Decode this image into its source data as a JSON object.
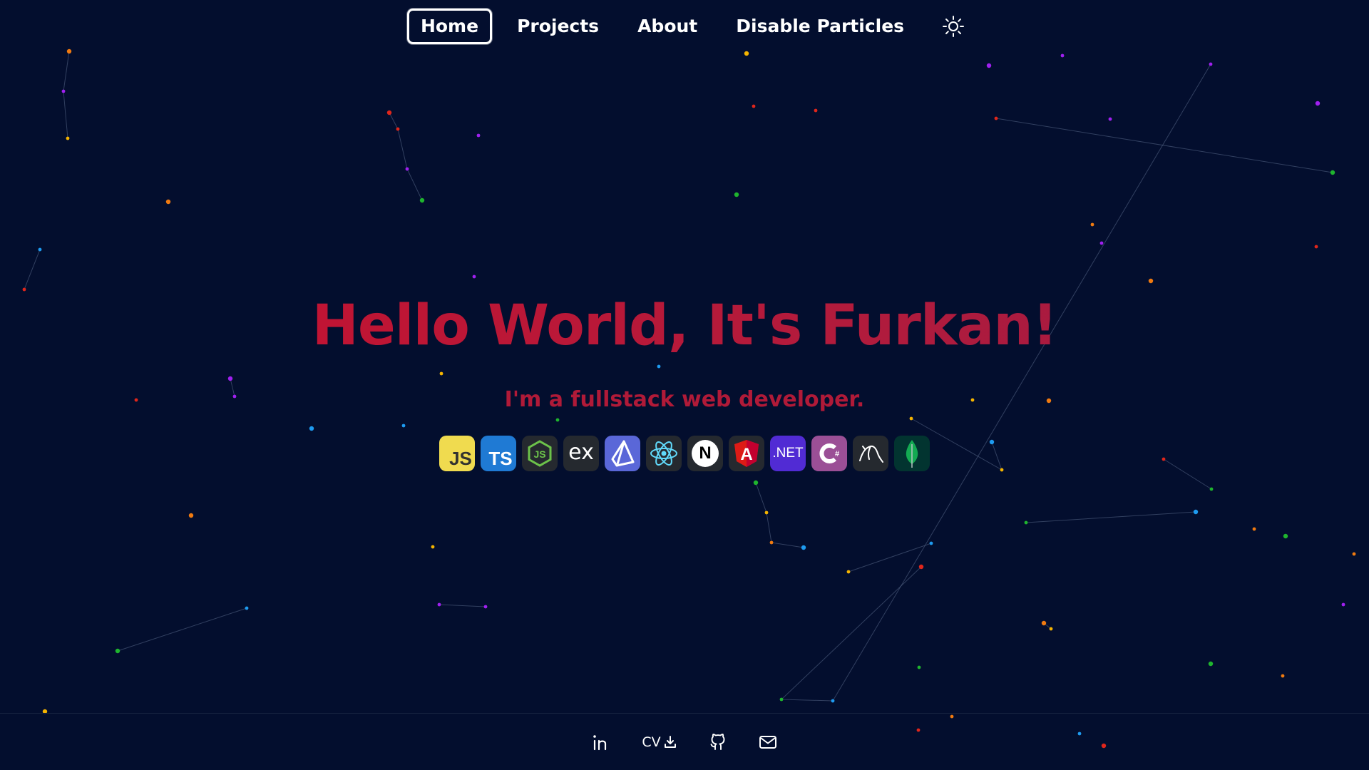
{
  "nav": {
    "items": [
      {
        "label": "Home",
        "active": true
      },
      {
        "label": "Projects",
        "active": false
      },
      {
        "label": "About",
        "active": false
      },
      {
        "label": "Disable Particles",
        "active": false
      }
    ],
    "theme_toggle_icon": "sun-icon"
  },
  "hero": {
    "title": "Hello World, It's Furkan!",
    "subtitle": "I'm a fullstack web developer."
  },
  "tech_icons": [
    {
      "name": "javascript-icon",
      "text": "JS"
    },
    {
      "name": "typescript-icon",
      "text": "TS"
    },
    {
      "name": "nodejs-icon",
      "text": "JS"
    },
    {
      "name": "express-icon",
      "text": "ex"
    },
    {
      "name": "prisma-icon",
      "text": ""
    },
    {
      "name": "react-icon",
      "text": ""
    },
    {
      "name": "nextjs-icon",
      "text": "N"
    },
    {
      "name": "angular-icon",
      "text": "A"
    },
    {
      "name": "dotnet-icon",
      "text": ".NET"
    },
    {
      "name": "csharp-icon",
      "text": "C#"
    },
    {
      "name": "mysql-icon",
      "text": ""
    },
    {
      "name": "mongodb-icon",
      "text": ""
    }
  ],
  "footer": {
    "links": [
      {
        "name": "linkedin-icon"
      },
      {
        "name": "cv-download",
        "label": "CV"
      },
      {
        "name": "github-icon"
      },
      {
        "name": "mail-icon"
      }
    ]
  },
  "colors": {
    "background": "#030e2e",
    "title_gradient_start": "#c8102e",
    "title_gradient_end": "#9d1a44",
    "particle_palette": [
      "#f5b400",
      "#a020f0",
      "#e0261b",
      "#1fb52e",
      "#1e9bf0",
      "#f07a10"
    ]
  }
}
